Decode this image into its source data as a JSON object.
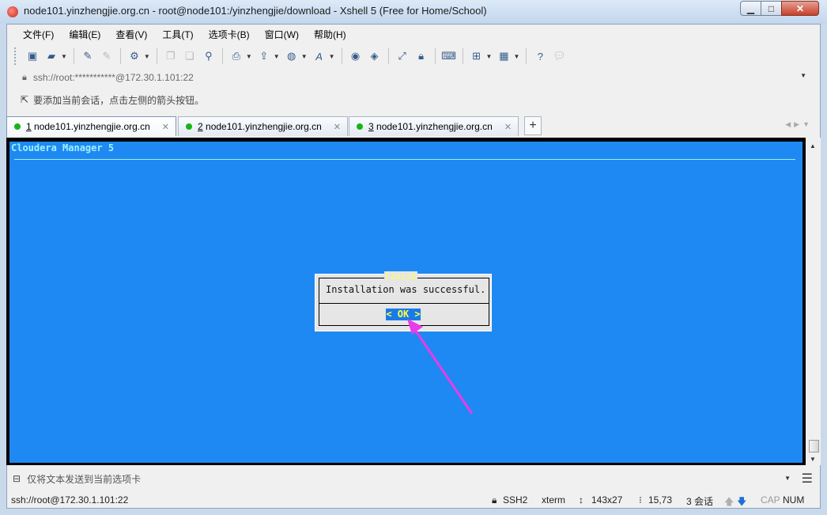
{
  "window": {
    "title": "node101.yinzhengjie.org.cn - root@node101:/yinzhengjie/download - Xshell 5 (Free for Home/School)",
    "controls": {
      "minimize": "▁",
      "maximize": "□",
      "close": "✕"
    }
  },
  "menu": [
    "文件(F)",
    "编辑(E)",
    "查看(V)",
    "工具(T)",
    "选项卡(B)",
    "窗口(W)",
    "帮助(H)"
  ],
  "address": {
    "text": "ssh://root:***********@172.30.1.101:22"
  },
  "hint": {
    "text": "要添加当前会话，点击左侧的箭头按钮。"
  },
  "tabs": [
    {
      "number": "1",
      "label": "node101.yinzhengjie.org.cn",
      "active": true
    },
    {
      "number": "2",
      "label": "node101.yinzhengjie.org.cn",
      "active": false
    },
    {
      "number": "3",
      "label": "node101.yinzhengjie.org.cn",
      "active": false
    }
  ],
  "tab_add": "+",
  "terminal": {
    "title": "Cloudera Manager 5",
    "background": "#1e89f2",
    "dialog": {
      "title": "Finish",
      "message": "Installation was successful.",
      "button": "< OK >"
    }
  },
  "compose": {
    "placeholder": "仅将文本发送到当前选项卡"
  },
  "status": {
    "connection": "ssh://root@172.30.1.101:22",
    "protocol": "SSH2",
    "terminal_type": "xterm",
    "size": "143x27",
    "cursor": "15,73",
    "sessions": "3 会话",
    "caps": "CAP",
    "num": "NUM"
  },
  "colors": {
    "accent_arrow": "#e83ce8",
    "tab_dot": "#19b319",
    "dialog_title": "#ffff5a",
    "ok_button_bg": "#1a7be8"
  }
}
